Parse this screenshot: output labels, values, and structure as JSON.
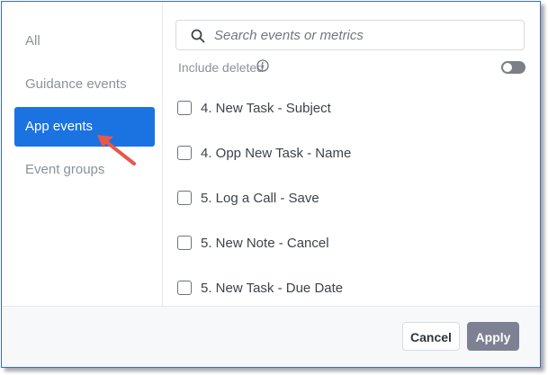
{
  "sidebar": {
    "items": [
      {
        "label": "All",
        "active": false
      },
      {
        "label": "Guidance events",
        "active": false
      },
      {
        "label": "App events",
        "active": true
      },
      {
        "label": "Event groups",
        "active": false
      }
    ]
  },
  "search": {
    "placeholder": "Search events or metrics",
    "value": ""
  },
  "include_deleted": {
    "label": "Include deleted",
    "enabled": false
  },
  "events": [
    {
      "label": "4. New Task - Subject",
      "checked": false
    },
    {
      "label": "4. Opp New Task - Name",
      "checked": false
    },
    {
      "label": "5. Log a Call - Save",
      "checked": false
    },
    {
      "label": "5. New Note - Cancel",
      "checked": false
    },
    {
      "label": "5. New Task - Due Date",
      "checked": false
    }
  ],
  "footer": {
    "cancel_label": "Cancel",
    "apply_label": "Apply"
  },
  "colors": {
    "accent": "#1a73e0",
    "apply_button": "#7e8194",
    "annotation_arrow": "#e8574a"
  },
  "icons": {
    "search": "search-icon",
    "info": "info-icon",
    "annotation": "arrow-annotation-icon"
  }
}
